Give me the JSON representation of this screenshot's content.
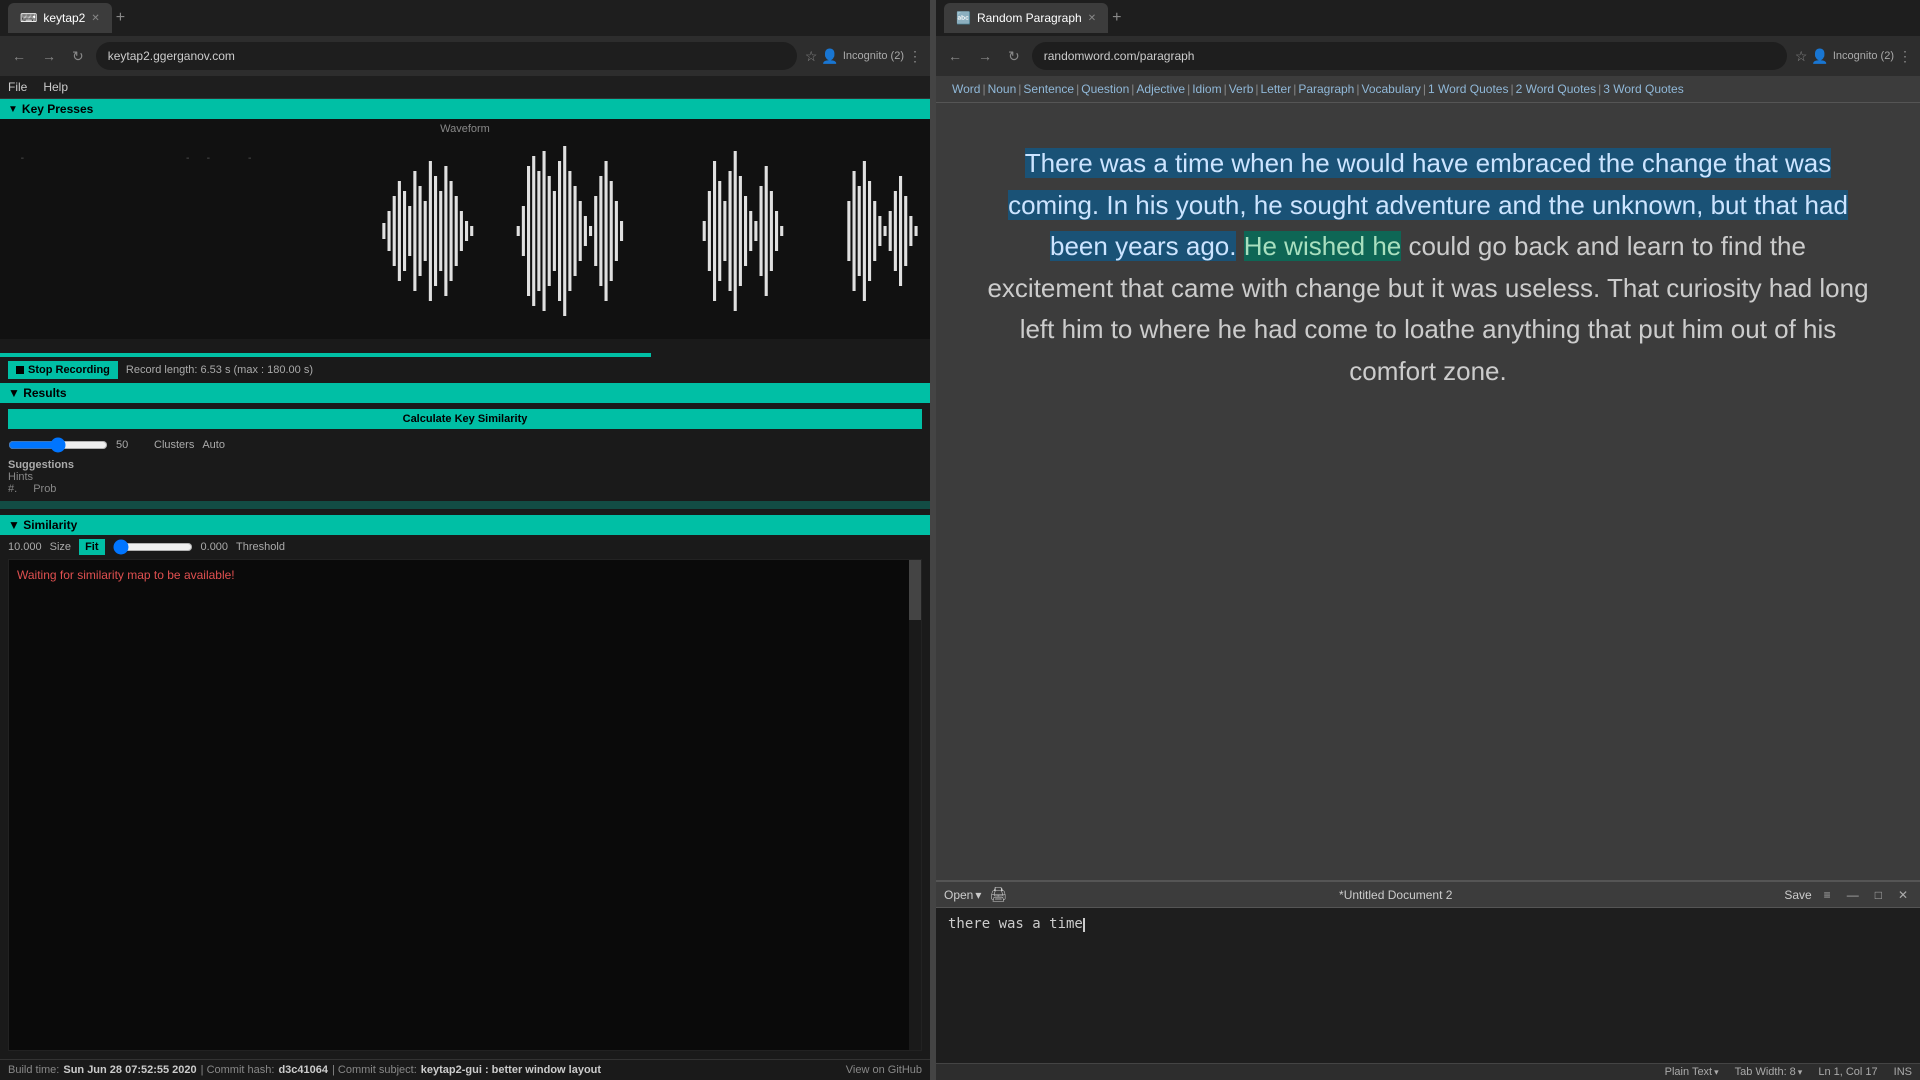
{
  "left": {
    "tab": {
      "title": "keytap2",
      "url": "keytap2.ggerganov.com",
      "incognito": "Incognito (2)"
    },
    "menu": {
      "file": "File",
      "help": "Help"
    },
    "keypresses": {
      "label": "Key Presses"
    },
    "waveform": {
      "label": "Waveform"
    },
    "controls": {
      "stop_button": "Stop Recording",
      "record_info": "Record length: 6.53 s (max : 180.00 s)"
    },
    "results": {
      "label": "Results",
      "calc_button": "Calculate Key Similarity",
      "slider_val": "50",
      "clusters": "Clusters",
      "auto": "Auto",
      "suggestions": "Suggestions",
      "hints": "Hints",
      "hash": "#.",
      "prob": "Prob"
    },
    "similarity": {
      "label": "Similarity",
      "size_label": "Size",
      "fit_btn": "Fit",
      "size_val": "10.000",
      "threshold_val": "0.000",
      "threshold_label": "Threshold",
      "waiting_msg": "Waiting for similarity map to be available!"
    },
    "status": {
      "build_label": "Build time:",
      "build_time": "Sun Jun 28 07:52:55 2020",
      "commit_label": "| Commit hash:",
      "commit_hash": "d3c41064",
      "subject_label": "| Commit subject:",
      "subject": "keytap2-gui : better window layout",
      "github_link": "View on GitHub"
    }
  },
  "right": {
    "tab": {
      "title": "Random Paragraph",
      "url": "randomword.com/paragraph",
      "incognito": "Incognito (2)"
    },
    "nav_links": [
      "Word",
      "Noun",
      "Sentence",
      "Question",
      "Adjective",
      "Idiom",
      "Verb",
      "Letter",
      "Paragraph",
      "Vocabulary",
      "1 Word Quotes",
      "2 Word Quotes",
      "3 Word Quotes"
    ],
    "paragraph": "There was a time when he would have embraced the change that was coming. In his youth, he sought adventure and the unknown, but that had been years ago. He wished he could go back and learn to find the excitement that came with change but it was useless. That curiosity had long left him to where he had come to loathe anything that put him out of his comfort zone.",
    "paragraph_highlight1_start": 0,
    "paragraph_highlight1_end": 267,
    "paragraph_highlight2_start": 267,
    "paragraph_highlight2_end": 305,
    "editor": {
      "title": "*Untitled Document 2",
      "open_btn": "Open",
      "save_btn": "Save",
      "content": "there was a time",
      "plain_text": "Plain Text",
      "tab_width": "Tab Width: 8",
      "position": "Ln 1, Col 17",
      "ins": "INS"
    }
  }
}
